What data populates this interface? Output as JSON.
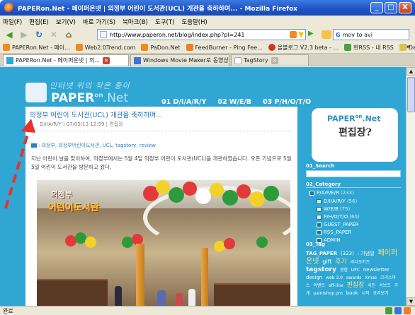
{
  "window": {
    "title": "PAPERon.Net - 페이퍼온넷 | 의정부 어린이 도서관(UCL) 개관을 축하하며... - Mozilla Firefox",
    "minimize": "_",
    "maximize": "□",
    "close": "X"
  },
  "menu": [
    "파일(F)",
    "편집(E)",
    "보기(V)",
    "바로 가기(S)",
    "북마크(B)",
    "도구(T)",
    "도움말(H)"
  ],
  "nav": {
    "url": "http://www.paperon.net/blog/index.php?pl=241",
    "search_value": "mov to avi",
    "search_engine_letter": "G"
  },
  "bookmarks": [
    {
      "label": "PAPERon.Net - 페이...",
      "icon": "rss-icon"
    },
    {
      "label": "Web2.0Trend.com",
      "icon": "rss-icon"
    },
    {
      "label": "PaDon.Net",
      "icon": "rss-icon"
    },
    {
      "label": "FeedBurner - Ping Fee...",
      "icon": "flame-icon"
    },
    {
      "label": "올블로그 V2.3 beta - ...",
      "icon": "apple-icon"
    },
    {
      "label": "한RSS - 내 RSS",
      "icon": "hanrss-icon"
    },
    {
      "label": "Daum DNA Lens",
      "icon": "bird-icon"
    }
  ],
  "bookmarks_more": "»",
  "tabs": [
    {
      "label": "PAPERon.Net - 페이퍼온넷 | 의...",
      "active": true
    },
    {
      "label": "Windows Movie Maker로 동영상 만들기",
      "active": false
    },
    {
      "label": "TagStory",
      "active": false
    }
  ],
  "blog": {
    "tagline": "인터넷 위의 작은 종이",
    "title_main": "PAPER",
    "title_sup": "on",
    "title_suffix": ".Net",
    "nav": [
      "01 D/I/A/R/Y",
      "02 W/E/B",
      "03 P/H/O/T/O"
    ]
  },
  "post": {
    "title": "의정부 어린이 도서관(UCL) 개관을 축하하며...",
    "meta": "D/I/A/R/Y | 07/05/13 12:59 | 편집장",
    "tags": ": 의정부, 의정부어린이도서관, UCL, tagstory, review",
    "body": "지난 어린이 날을 맞이하여, 의정부에서는 5월 4일 의정부 어린이 도서관(UCL)을 개관하였습니다. 오픈 기념으로 5월 5일 어린이 도서관을 방문하고 왔다.",
    "photo_sign_top": "의정부",
    "photo_sign_main": "어린이도서관"
  },
  "sidebar": {
    "brand_main": "PAPER",
    "brand_sup": "on",
    "brand_suffix": ".Net",
    "slogan": "편집장?",
    "search_head": "01_Search",
    "category_head": "02_Category",
    "categories": [
      {
        "label": "P/A/P/E/R",
        "count": "(233)"
      },
      {
        "label": "D/I/A/R/Y",
        "count": "(56)"
      },
      {
        "label": "W/E/B",
        "count": "(75)"
      },
      {
        "label": "P/H/O/T/O",
        "count": "(60)"
      },
      {
        "label": "GUEST_PAPER",
        "count": ""
      },
      {
        "label": "RSS_PAPER",
        "count": ""
      },
      {
        "label": "ADMIN",
        "count": ""
      }
    ],
    "tag_head": "03_Tag",
    "tag_paper_label": "TAG_PAPER",
    "tag_paper_count": "(323)",
    "tags": [
      {
        "text": ": 기념일",
        "size": 7
      },
      {
        "text": "페이퍼온넷",
        "size": 10
      },
      {
        "text": "gift",
        "size": 8
      },
      {
        "text": "후기",
        "size": 9
      },
      {
        "text": "라디오키즈",
        "size": 6
      },
      {
        "text": "tagstory",
        "size": 9
      },
      {
        "text": "경험",
        "size": 6
      },
      {
        "text": "UPC",
        "size": 6
      },
      {
        "text": "newsletter",
        "size": 7
      },
      {
        "text": "design",
        "size": 7
      },
      {
        "text": "web 3.0",
        "size": 6
      },
      {
        "text": "awards",
        "size": 6
      },
      {
        "text": "Xmas",
        "size": 6
      },
      {
        "text": "크리스마스",
        "size": 6
      },
      {
        "text": "이벤트",
        "size": 6
      },
      {
        "text": "off-line",
        "size": 6
      },
      {
        "text": "편집장",
        "size": 9
      },
      {
        "text": "사진",
        "size": 6
      },
      {
        "text": "서브즈",
        "size": 6
      },
      {
        "text": "가게",
        "size": 6
      },
      {
        "text": "paintshop pro",
        "size": 6
      },
      {
        "text": "book",
        "size": 7
      },
      {
        "text": "시작",
        "size": 6
      },
      {
        "text": "요리보기",
        "size": 6
      }
    ]
  },
  "status": {
    "text": "완료"
  },
  "colors": {
    "page_bg": "#2fa6d4",
    "titlebar": "#1f55c8",
    "post_title": "#1e6fb0",
    "annotation": "#e8322a"
  }
}
